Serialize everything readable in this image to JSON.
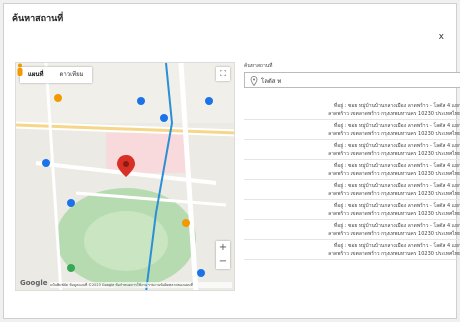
{
  "dialog": {
    "title": "ค้นหาสถานที่",
    "close": "x"
  },
  "map": {
    "tabs": [
      "แผนที่",
      "ดาวเทียม"
    ],
    "fullscreen": "⛶",
    "zoom_in": "+",
    "zoom_out": "−",
    "google": "Google",
    "attribution": "แป้นพิมพ์ลัด ข้อมูลแผนที่ ©2023 Google ข้อกำหนดการใช้งาน รายงานข้อผิดพลาดของแผนที่",
    "pin_color": "#d93025",
    "park_color": "#b7dbb0",
    "road_color": "#ffffff",
    "route_color": "#2a8fd6"
  },
  "search": {
    "label": "ค้นหาสถานที่",
    "value": "โลตัส ท"
  },
  "results": [
    {
      "line1": "ที่อยู่ : ซอย หมู่บ้านบ้านกลางเมือง ลาดพร้าว - โลตัส 4 แยก",
      "line2": "ลาดพร้าว เขตลาดพร้าว กรุงเทพมหานคร 10230 ประเทศไทย"
    },
    {
      "line1": "ที่อยู่ : ซอย หมู่บ้านบ้านกลางเมือง ลาดพร้าว - โลตัส 4 แยก",
      "line2": "ลาดพร้าว เขตลาดพร้าว กรุงเทพมหานคร 10230 ประเทศไทย"
    },
    {
      "line1": "ที่อยู่ : ซอย หมู่บ้านบ้านกลางเมือง ลาดพร้าว - โลตัส 4 แยก",
      "line2": "ลาดพร้าว เขตลาดพร้าว กรุงเทพมหานคร 10230 ประเทศไทย"
    },
    {
      "line1": "ที่อยู่ : ซอย หมู่บ้านบ้านกลางเมือง ลาดพร้าว - โลตัส 4 แยก",
      "line2": "ลาดพร้าว เขตลาดพร้าว กรุงเทพมหานคร 10230 ประเทศไทย"
    },
    {
      "line1": "ที่อยู่ : ซอย หมู่บ้านบ้านกลางเมือง ลาดพร้าว - โลตัส 4 แยก",
      "line2": "ลาดพร้าว เขตลาดพร้าว กรุงเทพมหานคร 10230 ประเทศไทย"
    },
    {
      "line1": "ที่อยู่ : ซอย หมู่บ้านบ้านกลางเมือง ลาดพร้าว - โลตัส 4 แยก",
      "line2": "ลาดพร้าว เขตลาดพร้าว กรุงเทพมหานคร 10230 ประเทศไทย"
    },
    {
      "line1": "ที่อยู่ : ซอย หมู่บ้านบ้านกลางเมือง ลาดพร้าว - โลตัส 4 แยก",
      "line2": "ลาดพร้าว เขตลาดพร้าว กรุงเทพมหานคร 10230 ประเทศไทย"
    },
    {
      "line1": "ที่อยู่ : ซอย หมู่บ้านบ้านกลางเมือง ลาดพร้าว - โลตัส 4 แยก",
      "line2": "ลาดพร้าว เขตลาดพร้าว กรุงเทพมหานคร 10230 ประเทศไทย"
    }
  ]
}
